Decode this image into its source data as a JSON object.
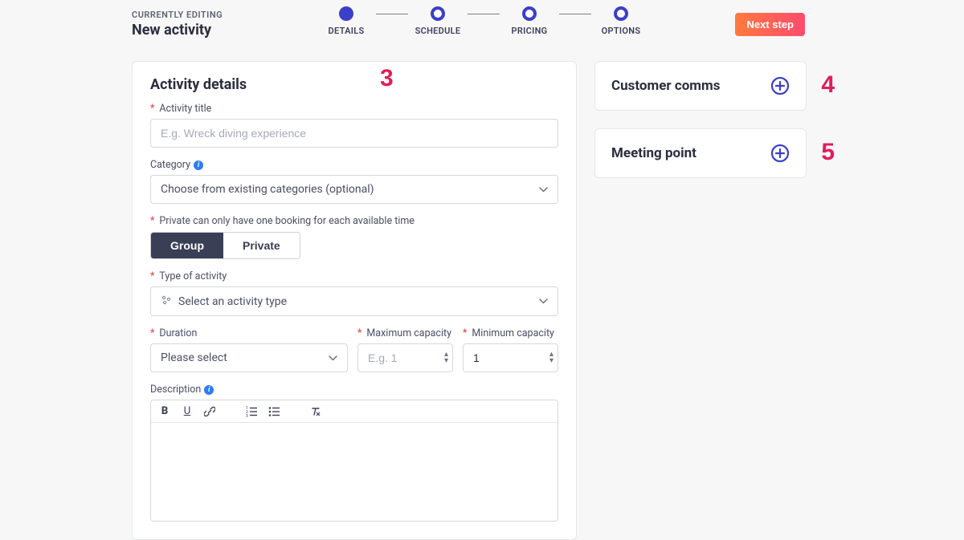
{
  "header": {
    "editing_label": "CURRENTLY EDITING",
    "editing_title": "New activity",
    "steps": [
      {
        "label": "DETAILS",
        "active": true
      },
      {
        "label": "SCHEDULE",
        "active": false
      },
      {
        "label": "PRICING",
        "active": false
      },
      {
        "label": "OPTIONS",
        "active": false
      }
    ],
    "next_button": "Next step"
  },
  "annotations": {
    "main": "3",
    "side1": "4",
    "side2": "5"
  },
  "main": {
    "title": "Activity details",
    "fields": {
      "activity_title": {
        "label": "Activity title",
        "required": true,
        "placeholder": "E.g. Wreck diving experience",
        "value": ""
      },
      "category": {
        "label": "Category",
        "info": true,
        "placeholder": "Choose from existing categories (optional)"
      },
      "booking_type": {
        "note": "Private can only have one booking for each available time",
        "required": true,
        "options": [
          "Group",
          "Private"
        ],
        "selected": "Group"
      },
      "activity_type": {
        "label": "Type of activity",
        "required": true,
        "placeholder": "Select an activity type"
      },
      "duration": {
        "label": "Duration",
        "required": true,
        "placeholder": "Please select"
      },
      "max_capacity": {
        "label": "Maximum capacity",
        "required": true,
        "placeholder": "E.g. 1",
        "value": ""
      },
      "min_capacity": {
        "label": "Minimum capacity",
        "required": true,
        "value": "1"
      },
      "description": {
        "label": "Description",
        "info": true
      }
    }
  },
  "side": {
    "comms_title": "Customer comms",
    "meeting_title": "Meeting point"
  }
}
